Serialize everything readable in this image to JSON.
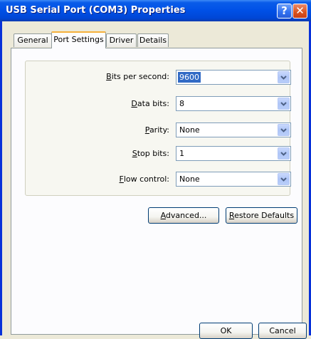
{
  "window": {
    "title": "USB Serial Port (COM3) Properties",
    "help_glyph": "?",
    "close_glyph": "✕"
  },
  "tabs": [
    {
      "label": "General",
      "active": false
    },
    {
      "label": "Port Settings",
      "active": true
    },
    {
      "label": "Driver",
      "active": false
    },
    {
      "label": "Details",
      "active": false
    }
  ],
  "settings": {
    "bits_per_second": {
      "label_access": "B",
      "label_rest": "its per second:",
      "value": "9600"
    },
    "data_bits": {
      "label_access": "D",
      "label_rest": "ata bits:",
      "value": "8"
    },
    "parity": {
      "label_access": "P",
      "label_rest": "arity:",
      "value": "None"
    },
    "stop_bits": {
      "label_access": "S",
      "label_rest": "top bits:",
      "value": "1"
    },
    "flow_control": {
      "label_access": "F",
      "label_rest": "low control:",
      "value": "None"
    }
  },
  "buttons": {
    "advanced": {
      "access": "A",
      "rest": "dvanced..."
    },
    "restore_defaults": {
      "access": "R",
      "rest": "estore Defaults"
    },
    "ok": "OK",
    "cancel": "Cancel"
  },
  "colors": {
    "titlebar": "#0050e6",
    "active_tab_accent": "#f6b13c",
    "selection": "#316ac5",
    "dialog_bg": "#ece9d8"
  }
}
